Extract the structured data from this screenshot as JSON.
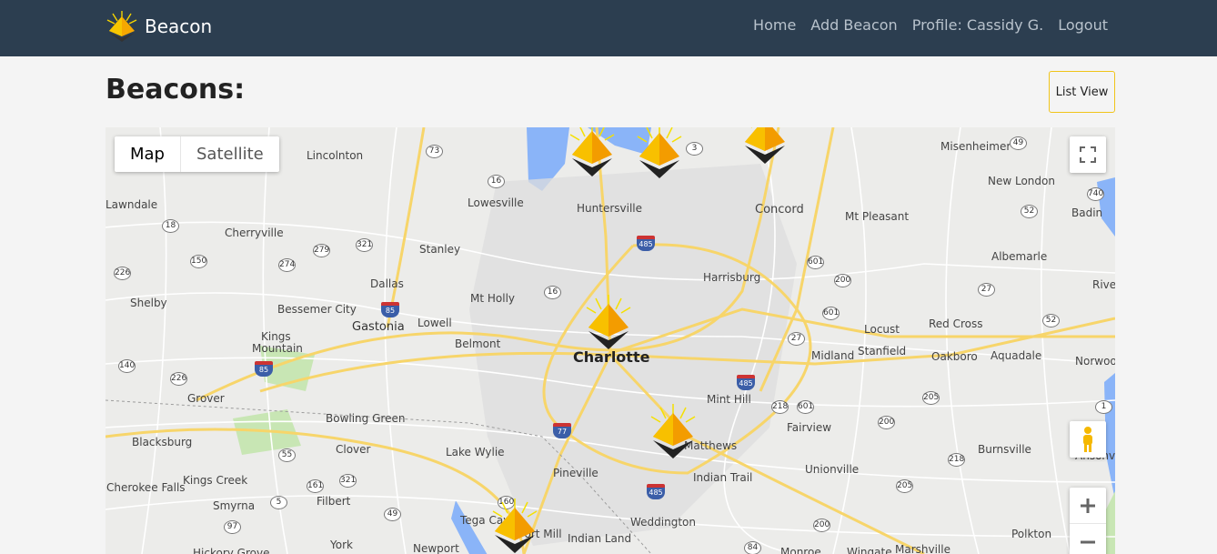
{
  "nav": {
    "brand": "Beacon",
    "links": [
      "Home",
      "Add Beacon",
      "Profile: Cassidy G.",
      "Logout"
    ]
  },
  "page": {
    "title": "Beacons:",
    "list_view_label": "List View"
  },
  "map": {
    "type_buttons": {
      "map": "Map",
      "satellite": "Satellite"
    },
    "cities": [
      "Lincolnton",
      "Lowesville",
      "Huntersville",
      "Concord",
      "Mt Pleasant",
      "Misenheimer",
      "New London",
      "Badin",
      "Lawndale",
      "Cherryville",
      "Stanley",
      "Harrisburg",
      "Albemarle",
      "River Ha",
      "Shelby",
      "Bessemer City",
      "Dallas",
      "Mt Holly",
      "Locust",
      "Red Cross",
      "Gastonia",
      "Lowell",
      "Belmont",
      "Charlotte",
      "Midland",
      "Stanfield",
      "Oakboro",
      "Aquadale",
      "Norwood",
      "Kings",
      "Mountain",
      "Mint Hill",
      "Grover",
      "Bowling Green",
      "Fairview",
      "Blacksburg",
      "Clover",
      "Lake Wylie",
      "Matthews",
      "Burnsville",
      "Ansonville",
      "Indian Trail",
      "Unionville",
      "Kings Creek",
      "Pineville",
      "Cherokee Falls",
      "Smyrna",
      "Filbert",
      "Tega Cay",
      "Weddington",
      "Fort Mill",
      "Indian Land",
      "Polkton",
      "York",
      "Newport",
      "Monroe",
      "Wingate",
      "Marshville",
      "Hickory Grove"
    ],
    "routes": [
      "73",
      "16",
      "3",
      "49",
      "740",
      "52",
      "18",
      "321",
      "279",
      "226",
      "150",
      "274",
      "485",
      "27",
      "601",
      "200",
      "16",
      "85",
      "601",
      "27",
      "52",
      "140",
      "226",
      "485",
      "218",
      "601",
      "205",
      "1",
      "55",
      "161",
      "321",
      "200",
      "218",
      "85",
      "77",
      "5",
      "97",
      "49",
      "160",
      "485",
      "205",
      "84",
      "200"
    ],
    "marker_count": 6
  }
}
